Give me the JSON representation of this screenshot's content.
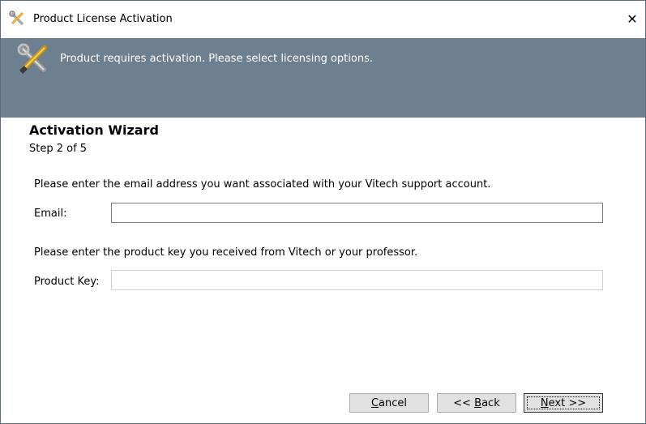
{
  "window": {
    "title": "Product License Activation",
    "title_icon": "tools-icon",
    "close_glyph": "✕"
  },
  "banner": {
    "icon": "tools-icon",
    "message": "Product requires activation. Please select licensing options."
  },
  "wizard": {
    "title": "Activation Wizard",
    "step": "Step 2 of 5"
  },
  "form": {
    "email_instruction": "Please enter the email address you want associated with your Vitech support account.",
    "email_label": "Email:",
    "email_value": "",
    "key_instruction": "Please enter the product key you received from Vitech or your professor.",
    "key_label": "Product Key:",
    "key_value": ""
  },
  "buttons": {
    "cancel": {
      "mnemonic": "C",
      "rest": "ancel"
    },
    "back": {
      "prefix": "<< ",
      "mnemonic": "B",
      "rest": "ack"
    },
    "next": {
      "mnemonic": "N",
      "rest": "ext >>"
    }
  },
  "colors": {
    "banner_bg": "#6e7f8f",
    "button_bg": "#e1e1e1"
  }
}
